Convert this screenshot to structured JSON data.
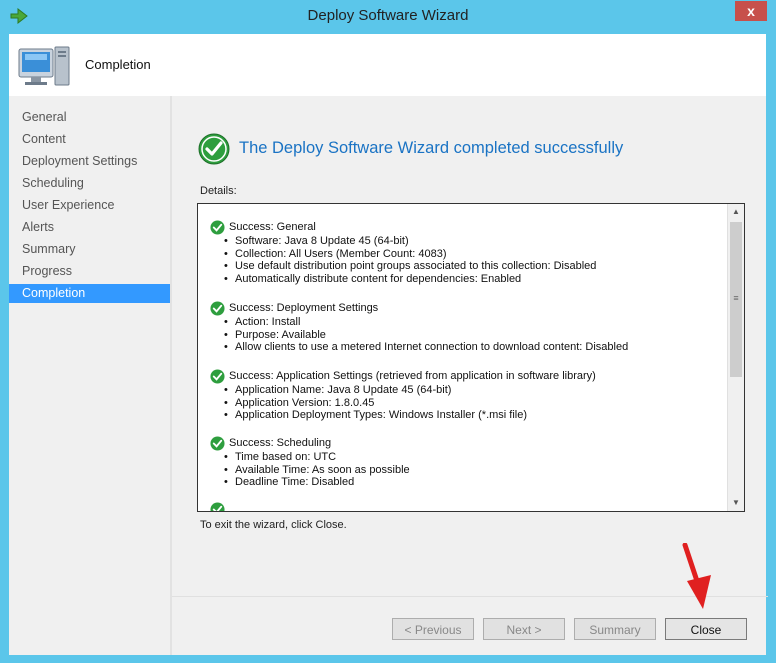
{
  "window": {
    "title": "Deploy Software Wizard",
    "close_glyph": "x"
  },
  "header": {
    "title": "Completion",
    "icon": "computer-icon"
  },
  "nav": {
    "items": [
      "General",
      "Content",
      "Deployment Settings",
      "Scheduling",
      "User Experience",
      "Alerts",
      "Summary",
      "Progress",
      "Completion"
    ],
    "active": "Completion"
  },
  "content": {
    "headline": "The Deploy Software Wizard completed successfully",
    "details_label": "Details:",
    "sections": [
      {
        "title": "Success: General",
        "items": [
          "Software: Java 8 Update 45 (64-bit)",
          "Collection: All Users (Member Count: 4083)",
          "Use default distribution point groups associated to this collection: Disabled",
          "Automatically distribute content for dependencies: Enabled"
        ]
      },
      {
        "title": "Success: Deployment Settings",
        "items": [
          "Action: Install",
          "Purpose: Available",
          "Allow clients to use a metered Internet connection to download content: Disabled"
        ]
      },
      {
        "title": "Success: Application Settings (retrieved from application in software library)",
        "items": [
          "Application Name: Java 8 Update 45 (64-bit)",
          "Application Version: 1.8.0.45",
          "Application Deployment Types: Windows Installer (*.msi file)"
        ]
      },
      {
        "title": "Success: Scheduling",
        "items": [
          "Time based on: UTC",
          "Available Time: As soon as possible",
          "Deadline Time: Disabled"
        ]
      }
    ],
    "exit_text": "To exit the wizard, click Close."
  },
  "buttons": {
    "previous": "< Previous",
    "next": "Next >",
    "summary": "Summary",
    "close": "Close"
  },
  "colors": {
    "frame": "#5bc6ea",
    "accent": "#1a73c4",
    "selection": "#3399ff",
    "success": "#2e9e3e",
    "arrow": "#e02020"
  }
}
